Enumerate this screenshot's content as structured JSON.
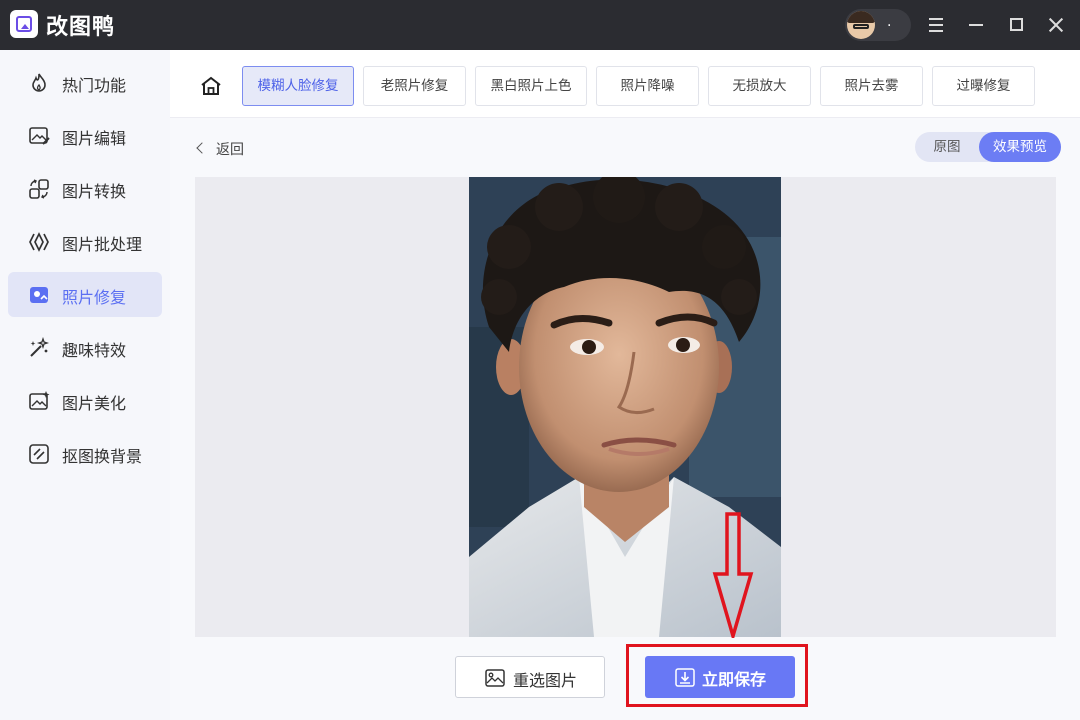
{
  "app": {
    "title": "改图鸭",
    "user_name": "."
  },
  "sidebar": {
    "items": [
      {
        "label": "热门功能",
        "icon": "flame-icon"
      },
      {
        "label": "图片编辑",
        "icon": "image-edit-icon"
      },
      {
        "label": "图片转换",
        "icon": "convert-icon"
      },
      {
        "label": "图片批处理",
        "icon": "batch-icon"
      },
      {
        "label": "照片修复",
        "icon": "photo-repair-icon"
      },
      {
        "label": "趣味特效",
        "icon": "magic-wand-icon"
      },
      {
        "label": "图片美化",
        "icon": "beautify-icon"
      },
      {
        "label": "抠图换背景",
        "icon": "cutout-icon"
      }
    ],
    "active_index": 4
  },
  "tabs": {
    "items": [
      {
        "label": "模糊人脸修复"
      },
      {
        "label": "老照片修复"
      },
      {
        "label": "黑白照片上色"
      },
      {
        "label": "照片降噪"
      },
      {
        "label": "无损放大"
      },
      {
        "label": "照片去雾"
      },
      {
        "label": "过曝修复"
      }
    ],
    "active_index": 0
  },
  "back": {
    "label": "返回"
  },
  "view_toggle": {
    "original_label": "原图",
    "preview_label": "效果预览",
    "selected": "preview"
  },
  "actions": {
    "reselect_label": "重选图片",
    "save_label": "立即保存"
  },
  "colors": {
    "accent": "#6878f5",
    "titlebar": "#2b2c31",
    "annotation_red": "#e0141e"
  }
}
